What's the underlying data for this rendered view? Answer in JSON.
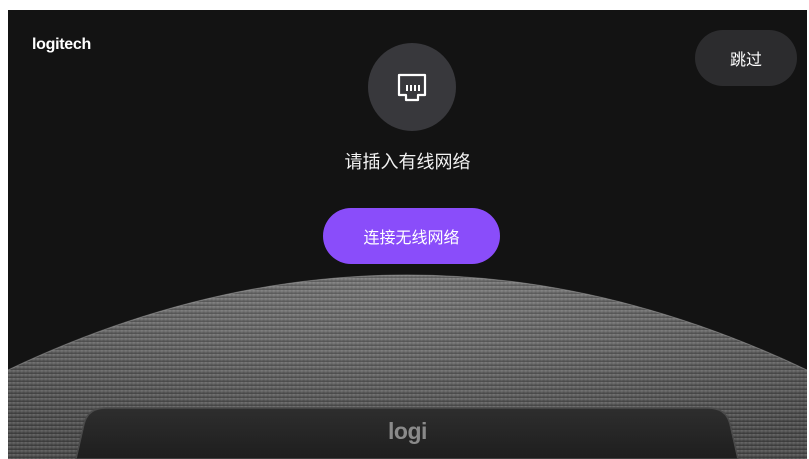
{
  "header": {
    "brand": "logitech",
    "skip_label": "跳过"
  },
  "main": {
    "icon": "ethernet-port-icon",
    "heading": "请插入有线网络",
    "wifi_button_label": "连接无线网络"
  },
  "device": {
    "logo": "logi"
  },
  "colors": {
    "background": "#131313",
    "accent": "#8a4dfa",
    "skip_button": "#2c2c2e",
    "icon_circle": "#38383c"
  }
}
